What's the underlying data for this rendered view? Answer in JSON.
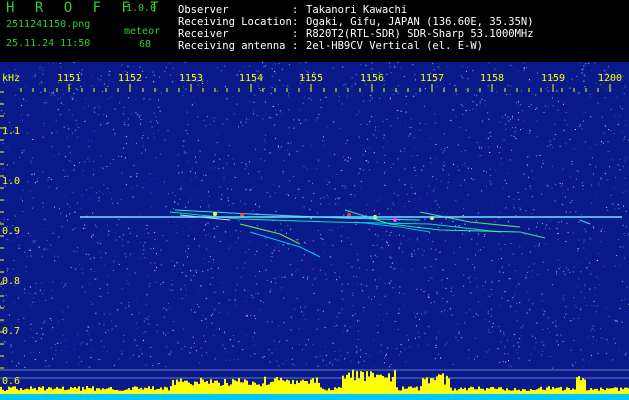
{
  "header": {
    "app_title": "H R O F F T",
    "app_version": "1.0.0",
    "filename": "2511241150.png",
    "datetime": "25.11.24 11:50",
    "meteor_label": "meteor",
    "meteor_count": "68",
    "info": [
      {
        "label": "Observer",
        "value": "Takanori Kawachi"
      },
      {
        "label": "Receiving Location",
        "value": "Ogaki, Gifu, JAPAN (136.60E, 35.35N)"
      },
      {
        "label": "Receiver",
        "value": "R820T2(RTL-SDR) SDR-Sharp 53.1000MHz"
      },
      {
        "label": "Receiving antenna",
        "value": "2el-HB9CV Vertical (el. E-W)"
      }
    ],
    "separator": ":"
  },
  "spectrogram": {
    "freq_unit": "kHz",
    "freq_ticks": [
      "1151",
      "1152",
      "1153",
      "1154",
      "1155",
      "1156",
      "1157",
      "1158",
      "1159",
      "1200"
    ],
    "khz_ticks": [
      "1.1",
      "1.0",
      "0.9",
      "0.8",
      "0.7",
      "0.6"
    ],
    "colors": {
      "background": "#0a1a8a",
      "carrier": "#6fe0ff",
      "axis_text": "#ffff00",
      "histogram": "#ffff00",
      "histogram_base": "#00c8ff"
    }
  }
}
